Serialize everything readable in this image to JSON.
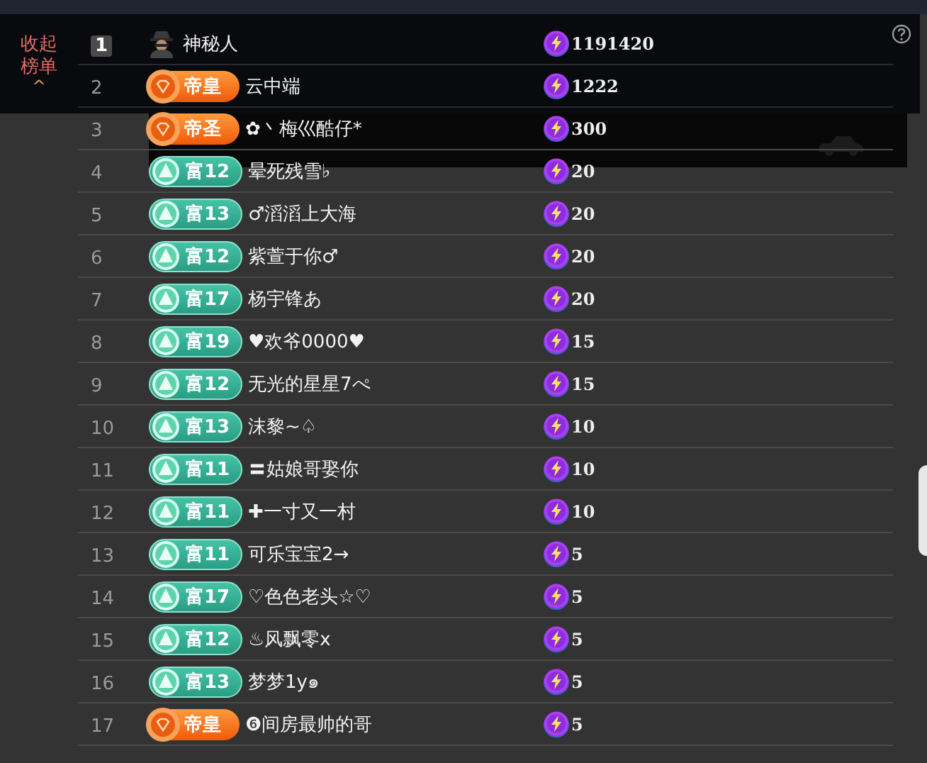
{
  "board": {
    "collapse_label": "收起榜单",
    "collapse_icon": "^",
    "rows": [
      {
        "rank": "1",
        "badge": {
          "kind": "mystery"
        },
        "name": "神秘人",
        "score": "1191420"
      },
      {
        "rank": "2",
        "badge": {
          "kind": "emperor",
          "label": "帝皇"
        },
        "name": "云中端",
        "score": "1222"
      },
      {
        "rank": "3",
        "badge": {
          "kind": "emperor",
          "label": "帝圣"
        },
        "name": "✿丶梅巛酷仔*",
        "score": "300"
      },
      {
        "rank": "4",
        "badge": {
          "kind": "wealth",
          "label": "富12"
        },
        "name": "晕死残雪♭",
        "score": "20"
      },
      {
        "rank": "5",
        "badge": {
          "kind": "wealth",
          "label": "富13"
        },
        "name": "♂滔滔上大海",
        "score": "20"
      },
      {
        "rank": "6",
        "badge": {
          "kind": "wealth",
          "label": "富12"
        },
        "name": "紫萱于你♂",
        "score": "20"
      },
      {
        "rank": "7",
        "badge": {
          "kind": "wealth",
          "label": "富17"
        },
        "name": "杨宇锋あ",
        "score": "20"
      },
      {
        "rank": "8",
        "badge": {
          "kind": "wealth",
          "label": "富19"
        },
        "name": "♥欢爷0000♥",
        "score": "15"
      },
      {
        "rank": "9",
        "badge": {
          "kind": "wealth",
          "label": "富12"
        },
        "name": "无光的星星7ぺ",
        "score": "15"
      },
      {
        "rank": "10",
        "badge": {
          "kind": "wealth",
          "label": "富13"
        },
        "name": "沫黎~♤",
        "score": "10"
      },
      {
        "rank": "11",
        "badge": {
          "kind": "wealth",
          "label": "富11"
        },
        "name": "〓姑娘哥娶你",
        "score": "10"
      },
      {
        "rank": "12",
        "badge": {
          "kind": "wealth",
          "label": "富11"
        },
        "name": "✚一寸又一村",
        "score": "10"
      },
      {
        "rank": "13",
        "badge": {
          "kind": "wealth",
          "label": "富11"
        },
        "name": "可乐宝宝2→",
        "score": "5"
      },
      {
        "rank": "14",
        "badge": {
          "kind": "wealth",
          "label": "富17"
        },
        "name": "♡色色老头☆♡",
        "score": "5"
      },
      {
        "rank": "15",
        "badge": {
          "kind": "wealth",
          "label": "富12"
        },
        "name": "♨风飘零x",
        "score": "5"
      },
      {
        "rank": "16",
        "badge": {
          "kind": "wealth",
          "label": "富13"
        },
        "name": "梦梦1y๑",
        "score": "5"
      },
      {
        "rank": "17",
        "badge": {
          "kind": "emperor",
          "label": "帝皇"
        },
        "name": "❻间房最帅的哥",
        "score": "5"
      }
    ]
  }
}
